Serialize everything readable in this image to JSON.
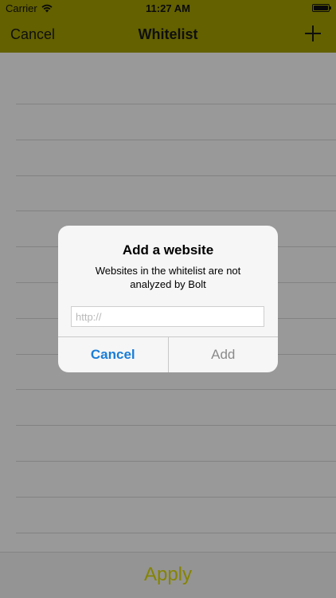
{
  "status_bar": {
    "carrier": "Carrier",
    "time": "11:27 AM"
  },
  "nav_bar": {
    "cancel_label": "Cancel",
    "title": "Whitelist",
    "add_icon": "plus-icon"
  },
  "list": {
    "rows": [
      "",
      "",
      "",
      "",
      "",
      "",
      "",
      "",
      "",
      "",
      "",
      "",
      ""
    ]
  },
  "bottom_bar": {
    "apply_label": "Apply"
  },
  "alert": {
    "title": "Add a website",
    "message": "Websites in the whitelist are not analyzed by Bolt",
    "input_value": "",
    "input_placeholder": "http://",
    "cancel_label": "Cancel",
    "add_label": "Add"
  },
  "colors": {
    "nav_background": "#a6a200",
    "apply_text": "#dedd00",
    "alert_cancel": "#1a7dd8",
    "alert_add_disabled": "#8a8a8a"
  }
}
